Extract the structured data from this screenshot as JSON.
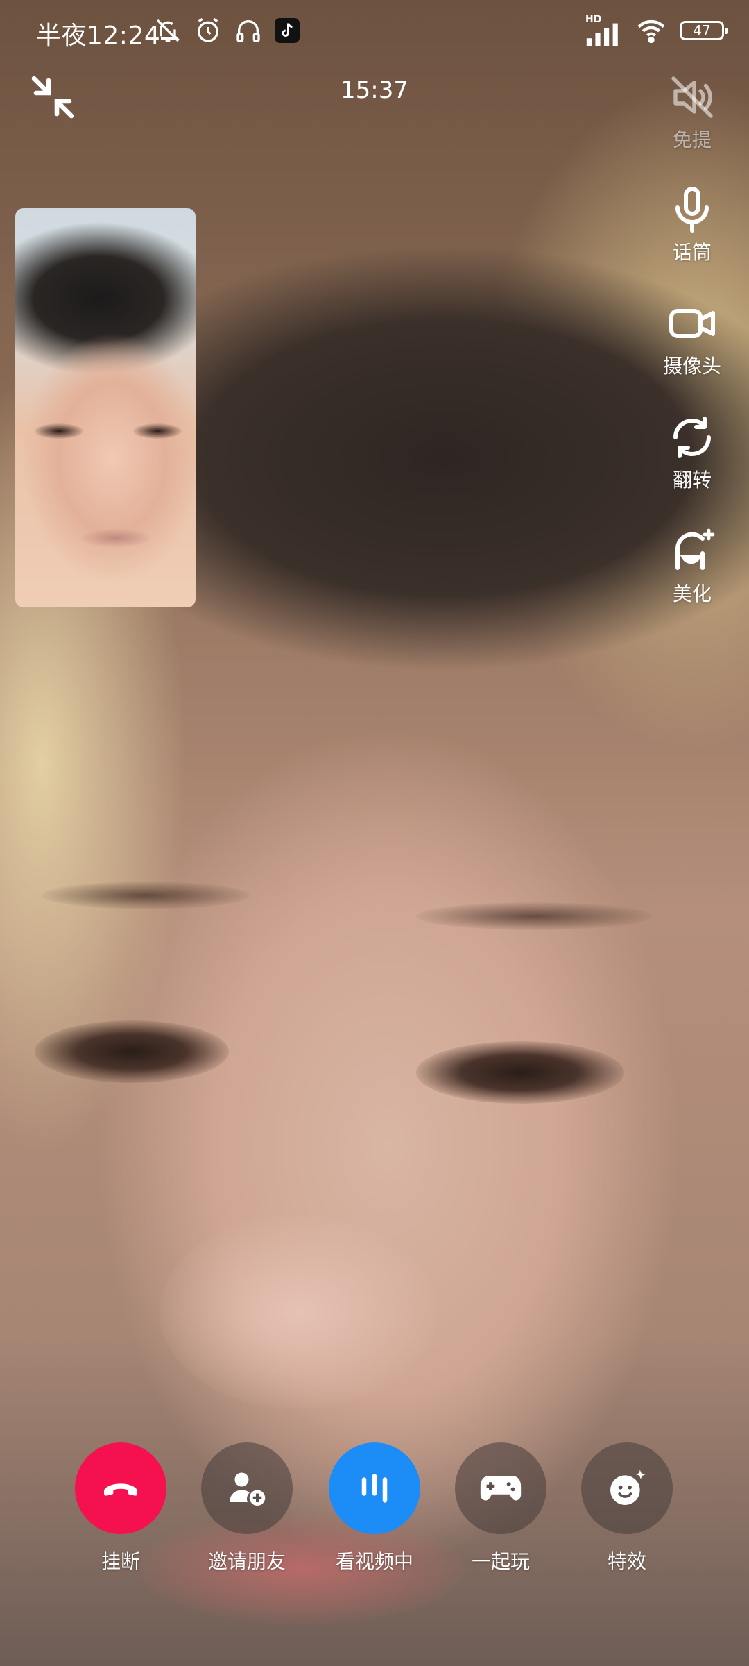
{
  "status_bar": {
    "time": "半夜12:24",
    "battery": "47",
    "network": "HD",
    "left_icons": [
      "mute-notification-icon",
      "alarm-icon",
      "headphones-icon",
      "tiktok-icon"
    ],
    "right_icons": [
      "signal-icon",
      "wifi-icon",
      "battery-icon"
    ]
  },
  "call": {
    "timer": "15:37"
  },
  "side_controls": [
    {
      "label": "免提",
      "icon": "speaker-off-icon",
      "enabled": false
    },
    {
      "label": "话筒",
      "icon": "microphone-icon",
      "enabled": true
    },
    {
      "label": "摄像头",
      "icon": "camera-icon",
      "enabled": true
    },
    {
      "label": "翻转",
      "icon": "flip-camera-icon",
      "enabled": true
    },
    {
      "label": "美化",
      "icon": "beauty-icon",
      "enabled": true
    }
  ],
  "bottom_controls": [
    {
      "label": "挂断",
      "icon": "hang-up-icon",
      "color": "#f5114f"
    },
    {
      "label": "邀请朋友",
      "icon": "invite-friend-icon"
    },
    {
      "label": "看视频中",
      "icon": "watch-video-icon",
      "color": "#1c8cf6"
    },
    {
      "label": "一起玩",
      "icon": "gamepad-icon"
    },
    {
      "label": "特效",
      "icon": "effects-icon"
    }
  ]
}
